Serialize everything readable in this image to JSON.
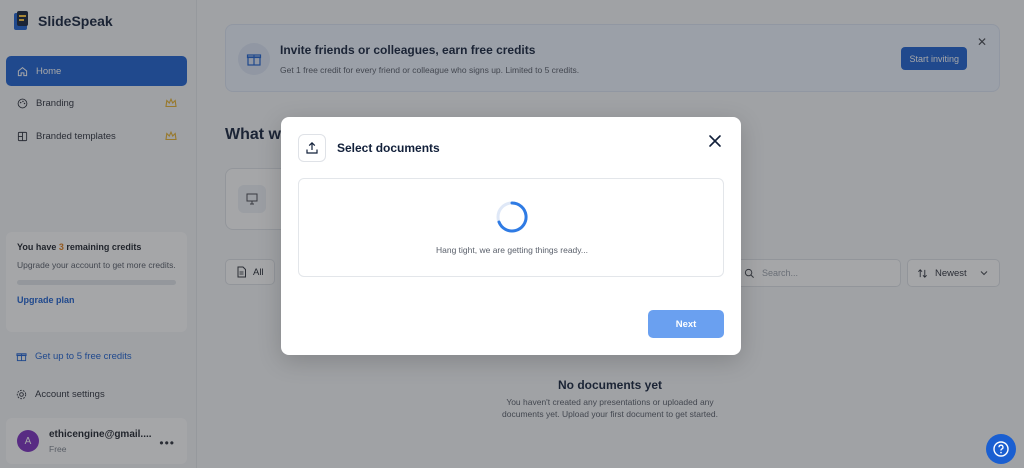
{
  "app": {
    "name": "SlideSpeak"
  },
  "sidebar": {
    "items": [
      {
        "label": "Home",
        "icon": "home-icon",
        "active": true
      },
      {
        "label": "Branding",
        "icon": "palette-icon",
        "premium": true
      },
      {
        "label": "Branded templates",
        "icon": "template-icon",
        "premium": true
      }
    ],
    "credits": {
      "prefix": "You have ",
      "count": "3",
      "suffix": " remaining credits",
      "subtitle": "Upgrade your account to get more credits.",
      "upgrade_label": "Upgrade plan"
    },
    "free_credits_label": "Get up to 5 free credits",
    "account_settings_label": "Account settings",
    "user": {
      "avatar_letter": "A",
      "email": "ethicengine@gmail....",
      "plan": "Free"
    }
  },
  "invite_banner": {
    "title": "Invite friends or colleagues, earn free credits",
    "subtitle": "Get 1 free credit for every friend or colleague who signs up. Limited to 5 credits.",
    "button_label": "Start inviting"
  },
  "main": {
    "heading": "What w",
    "filter_label": "All",
    "search_placeholder": "Search...",
    "sort_label": "Newest",
    "empty": {
      "title": "No documents yet",
      "subtitle": "You haven't created any presentations or uploaded any documents yet. Upload your first document to get started."
    }
  },
  "modal": {
    "title": "Select documents",
    "loading_text": "Hang tight, we are getting things ready...",
    "next_label": "Next"
  },
  "colors": {
    "accent": "#1a5fd1",
    "star": "#e8b22c",
    "credit_count": "#e07a14",
    "next_disabled": "#6aa0f0"
  }
}
